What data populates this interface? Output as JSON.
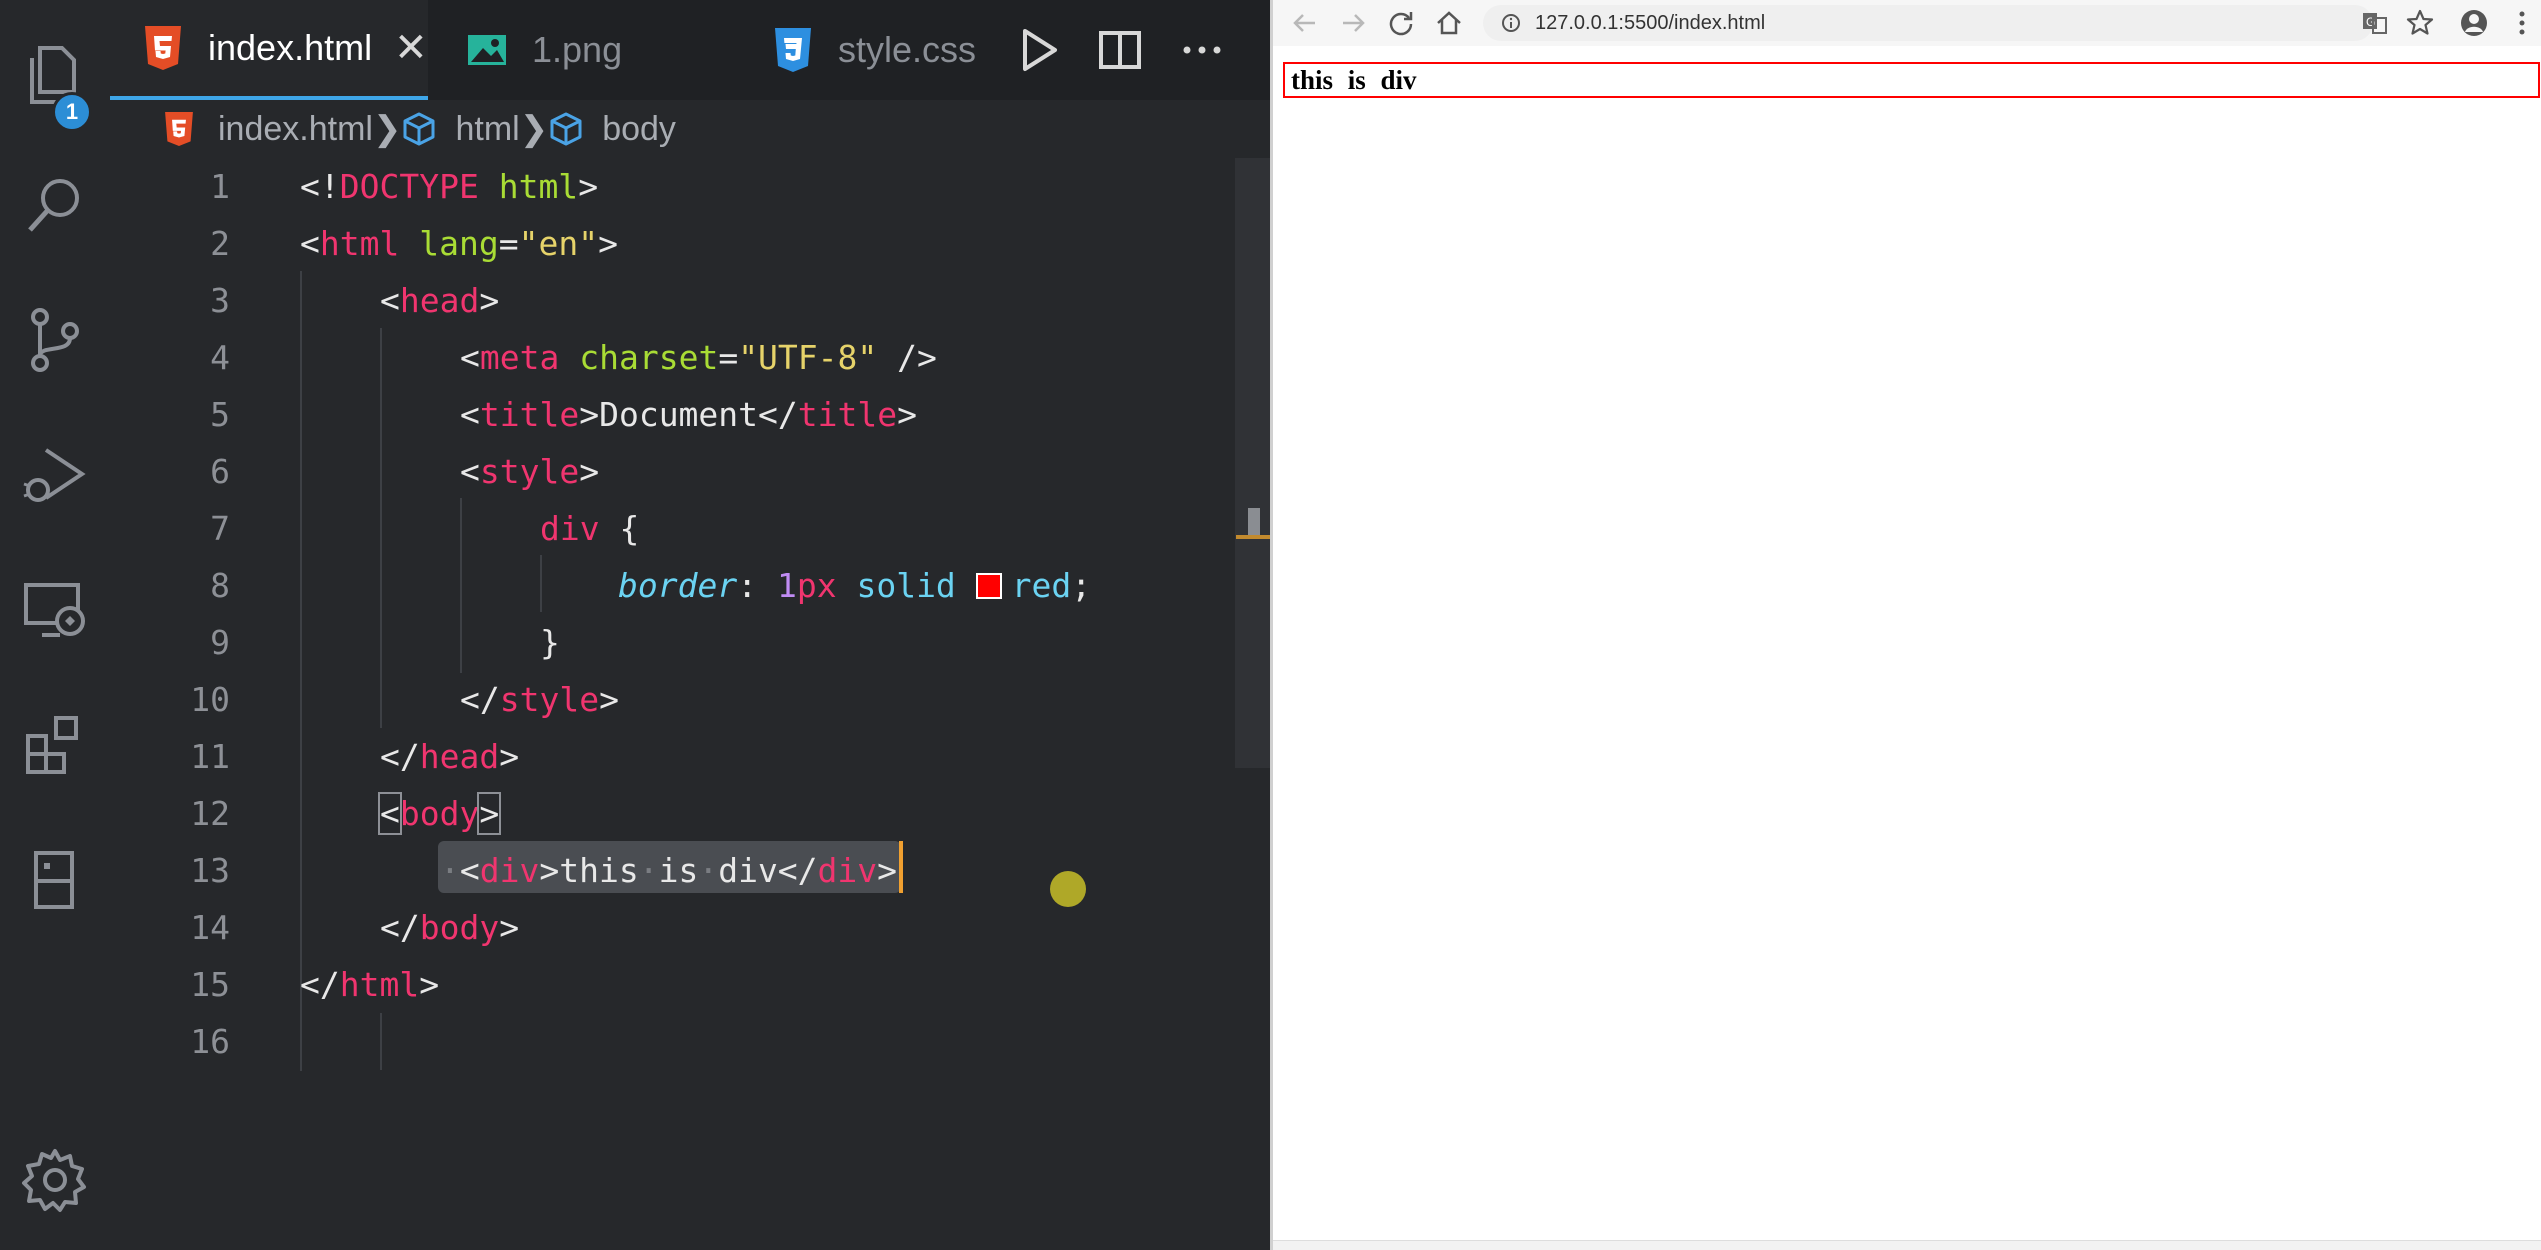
{
  "activity_bar": {
    "items": [
      "explorer-icon",
      "search-icon",
      "source-control-icon",
      "run-debug-icon",
      "remote-explorer-icon",
      "extensions-icon",
      "bookmarks-icon"
    ],
    "explorer_badge": "1",
    "settings": "gear-icon"
  },
  "tabs": [
    {
      "label": "index.html",
      "active": true,
      "icon": "html5-icon",
      "close": "✕"
    },
    {
      "label": "1.png",
      "active": false,
      "icon": "image-icon"
    },
    {
      "label": "style.css",
      "active": false,
      "icon": "css3-icon"
    }
  ],
  "tab_actions": [
    "run-icon",
    "split-editor-icon",
    "more-actions-icon"
  ],
  "breadcrumb": [
    "index.html",
    "html",
    "body"
  ],
  "line_numbers": [
    "1",
    "2",
    "3",
    "4",
    "5",
    "6",
    "7",
    "8",
    "9",
    "10",
    "11",
    "12",
    "13",
    "14",
    "15",
    "16"
  ],
  "code": {
    "l1": {
      "a": "<!",
      "b": "DOCTYPE",
      "c": " ",
      "d": "html",
      "e": ">"
    },
    "l2": {
      "a": "<",
      "b": "html",
      "c": " ",
      "d": "lang",
      "e": "=",
      "f": "\"en\"",
      "g": ">"
    },
    "l3": {
      "a": "<",
      "b": "head",
      "c": ">"
    },
    "l4": {
      "a": "<",
      "b": "meta",
      "c": " ",
      "d": "charset",
      "e": "=",
      "f": "\"UTF-8\"",
      "g": " />"
    },
    "l5": {
      "a": "<",
      "b": "title",
      "c": ">Document</",
      "d": "title",
      "e": ">"
    },
    "l6": {
      "a": "<",
      "b": "style",
      "c": ">"
    },
    "l7": {
      "a": "div",
      "b": " {"
    },
    "l8": {
      "a": "border",
      "b": ": ",
      "c": "1",
      "d": "px",
      "e": " solid ",
      "f": "red",
      "g": ";"
    },
    "l9": {
      "a": "}"
    },
    "l10": {
      "a": "</",
      "b": "style",
      "c": ">"
    },
    "l11": {
      "a": "</",
      "b": "head",
      "c": ">"
    },
    "l12": {
      "a": "<",
      "b": "body",
      "c": ">"
    },
    "l13": {
      "a": "·",
      "b": "<",
      "c": "div",
      "d": ">this",
      "e": "·",
      "f": "is",
      "g": "·",
      "h": "div</",
      "i": "div",
      "j": ">"
    },
    "l14": {
      "a": "</",
      "b": "body",
      "c": ">"
    },
    "l15": {
      "a": "</",
      "b": "html",
      "c": ">"
    }
  },
  "colors": {
    "swatch": "#ff0000",
    "accent": "#3ea6e8",
    "tag": "#f0356f"
  },
  "browser": {
    "url": "127.0.0.1:5500/index.html",
    "nav": [
      "back-icon",
      "forward-icon",
      "reload-icon",
      "home-icon"
    ],
    "toolbar_right": [
      "translate-icon",
      "bookmark-star-icon",
      "profile-icon",
      "menu-icon"
    ],
    "page_text": "this is div"
  }
}
